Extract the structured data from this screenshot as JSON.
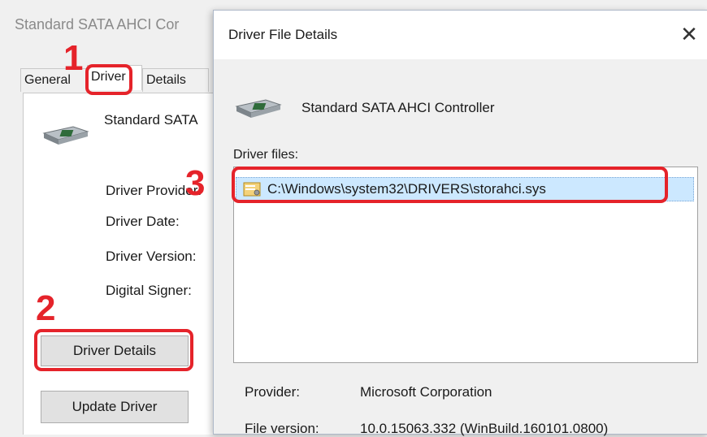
{
  "background_window": {
    "title": "Standard SATA AHCI Cor",
    "tabs": [
      {
        "label": "General"
      },
      {
        "label": "Driver"
      },
      {
        "label": "Details"
      }
    ],
    "device_name": "Standard SATA",
    "labels": {
      "provider": "Driver Provider:",
      "date": "Driver Date:",
      "version": "Driver Version:",
      "signer": "Digital Signer:"
    },
    "buttons": {
      "driver_details": "Driver Details",
      "update_driver": "Update Driver"
    }
  },
  "annotations": {
    "step1": "1",
    "step2": "2",
    "step3": "3",
    "color": "#e5232a"
  },
  "dialog": {
    "title": "Driver File Details",
    "close_glyph": "✕",
    "device_name": "Standard SATA AHCI Controller",
    "driver_files_label": "Driver files:",
    "files": [
      {
        "path": "C:\\Windows\\system32\\DRIVERS\\storahci.sys",
        "selected": true
      }
    ],
    "provider_label": "Provider:",
    "provider_value": "Microsoft Corporation",
    "file_version_label": "File version:",
    "file_version_value": "10.0.15063.332 (WinBuild.160101.0800)"
  },
  "icons": {
    "device": "sata-controller-icon",
    "file": "system-file-icon"
  }
}
